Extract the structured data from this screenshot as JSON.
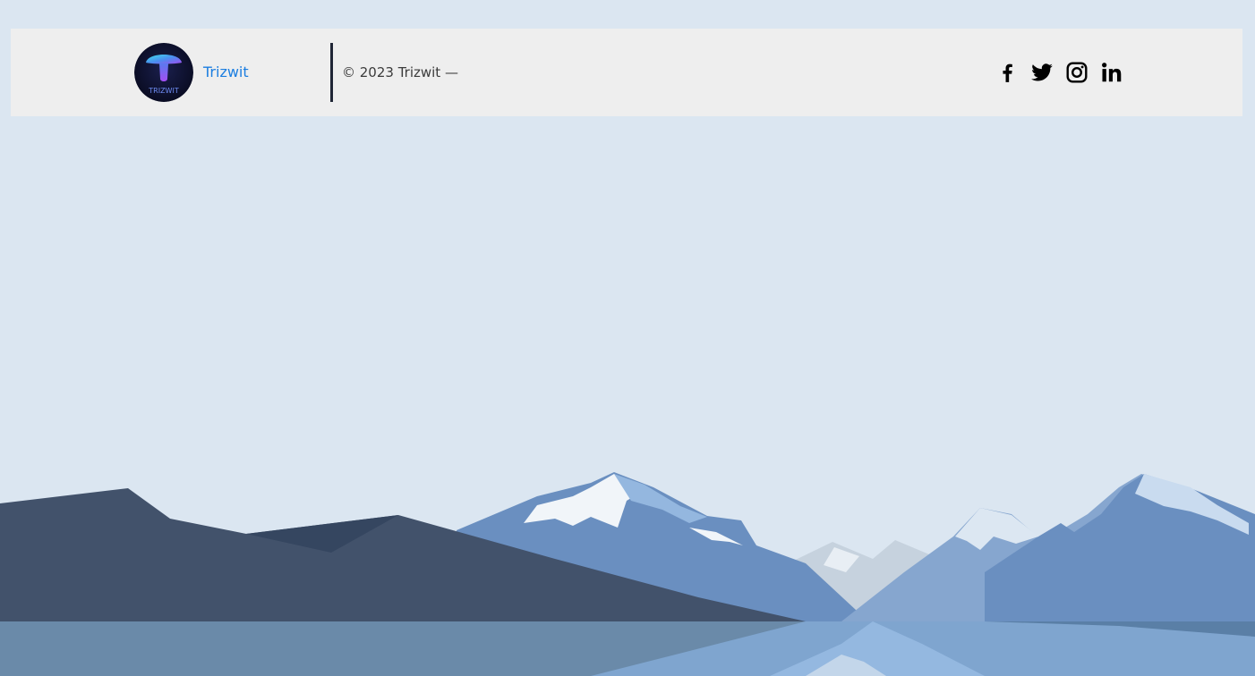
{
  "footer": {
    "brand": {
      "name": "Trizwit",
      "logo_text": "TRIZWIT",
      "logo_icon": "mushroom-logo-icon"
    },
    "copyright": "© 2023 Trizwit —",
    "social": [
      {
        "name": "facebook",
        "icon": "facebook-icon"
      },
      {
        "name": "twitter",
        "icon": "twitter-icon"
      },
      {
        "name": "instagram",
        "icon": "instagram-icon"
      },
      {
        "name": "linkedin",
        "icon": "linkedin-icon"
      }
    ]
  },
  "colors": {
    "background": "#dbe6f1",
    "footer_bar": "#eeeeee",
    "brand_link": "#1c7ee0",
    "divider": "#1f2535",
    "icons": "#000000",
    "mountain_dark": "#42526b",
    "mountain_mid": "#6a8fc0",
    "water": "#6a8aa9"
  }
}
